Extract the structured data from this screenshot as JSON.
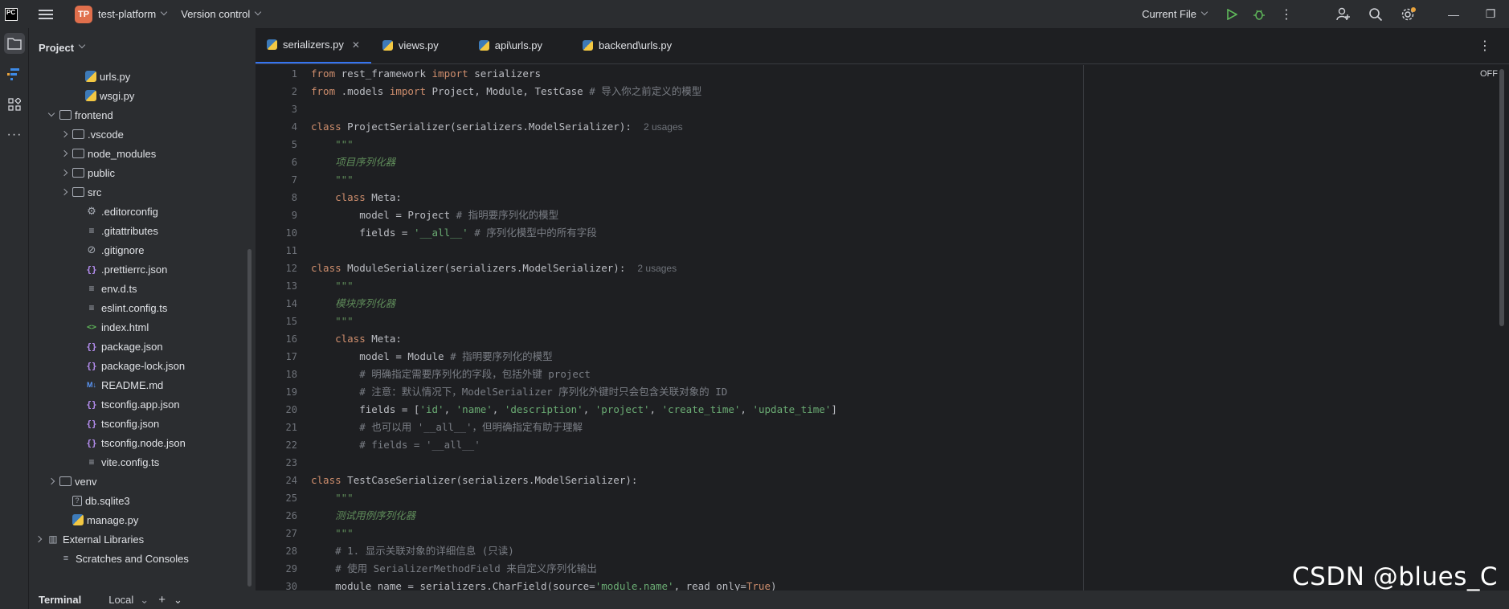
{
  "titlebar": {
    "logo_text": "PC",
    "project_badge": "TP",
    "project_name": "test-platform",
    "vcs_label": "Version control",
    "run_config": "Current File"
  },
  "toolstrip": {
    "items": [
      "project-view",
      "structure",
      "plugins",
      "more"
    ]
  },
  "project_panel": {
    "title": "Project",
    "tree": [
      {
        "label": "urls.py",
        "icon": "python-icon",
        "indent": 4
      },
      {
        "label": "wsgi.py",
        "icon": "python-icon",
        "indent": 4
      },
      {
        "label": "frontend",
        "icon": "folder-icon",
        "indent": 2,
        "expanded": true
      },
      {
        "label": ".vscode",
        "icon": "folder-icon",
        "indent": 3,
        "collapsed": true
      },
      {
        "label": "node_modules",
        "icon": "folder-icon",
        "indent": 3,
        "collapsed": true
      },
      {
        "label": "public",
        "icon": "folder-icon",
        "indent": 3,
        "collapsed": true
      },
      {
        "label": "src",
        "icon": "folder-icon",
        "indent": 3,
        "collapsed": true
      },
      {
        "label": ".editorconfig",
        "icon": "gear-icon",
        "indent": 4
      },
      {
        "label": ".gitattributes",
        "icon": "text-icon",
        "indent": 4
      },
      {
        "label": ".gitignore",
        "icon": "ignore-icon",
        "indent": 4
      },
      {
        "label": ".prettierrc.json",
        "icon": "json-icon",
        "indent": 4
      },
      {
        "label": "env.d.ts",
        "icon": "text-icon",
        "indent": 4
      },
      {
        "label": "eslint.config.ts",
        "icon": "text-icon",
        "indent": 4
      },
      {
        "label": "index.html",
        "icon": "html-icon",
        "indent": 4
      },
      {
        "label": "package.json",
        "icon": "json-icon",
        "indent": 4
      },
      {
        "label": "package-lock.json",
        "icon": "json-icon",
        "indent": 4
      },
      {
        "label": "README.md",
        "icon": "markdown-icon",
        "indent": 4
      },
      {
        "label": "tsconfig.app.json",
        "icon": "json-icon",
        "indent": 4
      },
      {
        "label": "tsconfig.json",
        "icon": "json-icon",
        "indent": 4
      },
      {
        "label": "tsconfig.node.json",
        "icon": "json-icon",
        "indent": 4
      },
      {
        "label": "vite.config.ts",
        "icon": "text-icon",
        "indent": 4
      },
      {
        "label": "venv",
        "icon": "folder-icon",
        "indent": 2,
        "collapsed": true
      },
      {
        "label": "db.sqlite3",
        "icon": "database-icon",
        "indent": 3
      },
      {
        "label": "manage.py",
        "icon": "python-icon",
        "indent": 3
      },
      {
        "label": "External Libraries",
        "icon": "library-icon",
        "indent": 1,
        "collapsed": true
      },
      {
        "label": "Scratches and Consoles",
        "icon": "console-icon",
        "indent": 2
      }
    ]
  },
  "tabs": [
    {
      "label": "serializers.py",
      "active": true
    },
    {
      "label": "views.py",
      "active": false
    },
    {
      "label": "api\\urls.py",
      "active": false
    },
    {
      "label": "backend\\urls.py",
      "active": false
    }
  ],
  "editor": {
    "reader_mode": "OFF",
    "line_numbers": [
      "1",
      "2",
      "3",
      "4",
      "5",
      "6",
      "7",
      "8",
      "9",
      "10",
      "11",
      "12",
      "13",
      "14",
      "15",
      "16",
      "17",
      "18",
      "19",
      "20",
      "21",
      "22",
      "23",
      "24",
      "25",
      "26",
      "27",
      "28",
      "29",
      "30"
    ],
    "lines": [
      [
        {
          "t": "from",
          "c": "kw"
        },
        {
          "t": " rest_framework "
        },
        {
          "t": "import",
          "c": "kw"
        },
        {
          "t": " serializers"
        }
      ],
      [
        {
          "t": "from",
          "c": "kw"
        },
        {
          "t": " .models "
        },
        {
          "t": "import",
          "c": "kw"
        },
        {
          "t": " Project, Module, TestCase "
        },
        {
          "t": "# 导入你之前定义的模型",
          "c": "cmt"
        }
      ],
      [],
      [
        {
          "t": "class",
          "c": "kw"
        },
        {
          "t": " ProjectSerializer(serializers.ModelSerializer):  "
        },
        {
          "t": "2 usages",
          "c": "hint"
        }
      ],
      [
        {
          "t": "    \"\"\"",
          "c": "doc"
        }
      ],
      [
        {
          "t": "    项目序列化器",
          "c": "doc"
        }
      ],
      [
        {
          "t": "    \"\"\"",
          "c": "doc"
        }
      ],
      [
        {
          "t": "    "
        },
        {
          "t": "class",
          "c": "kw"
        },
        {
          "t": " Meta:"
        }
      ],
      [
        {
          "t": "        model = Project "
        },
        {
          "t": "# 指明要序列化的模型",
          "c": "cmt"
        }
      ],
      [
        {
          "t": "        fields = "
        },
        {
          "t": "'__all__'",
          "c": "str"
        },
        {
          "t": " "
        },
        {
          "t": "# 序列化模型中的所有字段",
          "c": "cmt"
        }
      ],
      [],
      [
        {
          "t": "class",
          "c": "kw"
        },
        {
          "t": " ModuleSerializer(serializers.ModelSerializer):  "
        },
        {
          "t": "2 usages",
          "c": "hint"
        }
      ],
      [
        {
          "t": "    \"\"\"",
          "c": "doc"
        }
      ],
      [
        {
          "t": "    模块序列化器",
          "c": "doc"
        }
      ],
      [
        {
          "t": "    \"\"\"",
          "c": "doc"
        }
      ],
      [
        {
          "t": "    "
        },
        {
          "t": "class",
          "c": "kw"
        },
        {
          "t": " Meta:"
        }
      ],
      [
        {
          "t": "        model = Module "
        },
        {
          "t": "# 指明要序列化的模型",
          "c": "cmt"
        }
      ],
      [
        {
          "t": "        # 明确指定需要序列化的字段，包括外键 project",
          "c": "cmt"
        }
      ],
      [
        {
          "t": "        # 注意：默认情况下，ModelSerializer 序列化外键时只会包含关联对象的 ID",
          "c": "cmt"
        }
      ],
      [
        {
          "t": "        fields = ["
        },
        {
          "t": "'id'",
          "c": "str"
        },
        {
          "t": ", "
        },
        {
          "t": "'name'",
          "c": "str"
        },
        {
          "t": ", "
        },
        {
          "t": "'description'",
          "c": "str"
        },
        {
          "t": ", "
        },
        {
          "t": "'project'",
          "c": "str"
        },
        {
          "t": ", "
        },
        {
          "t": "'create_time'",
          "c": "str"
        },
        {
          "t": ", "
        },
        {
          "t": "'update_time'",
          "c": "str"
        },
        {
          "t": "]"
        }
      ],
      [
        {
          "t": "        # 也可以用 '__all__'，但明确指定有助于理解",
          "c": "cmt"
        }
      ],
      [
        {
          "t": "        # fields = '__all__'",
          "c": "cmt"
        }
      ],
      [],
      [
        {
          "t": "class",
          "c": "kw"
        },
        {
          "t": " TestCaseSerializer(serializers.ModelSerializer):"
        }
      ],
      [
        {
          "t": "    \"\"\"",
          "c": "doc"
        }
      ],
      [
        {
          "t": "    测试用例序列化器",
          "c": "doc"
        }
      ],
      [
        {
          "t": "    \"\"\"",
          "c": "doc"
        }
      ],
      [
        {
          "t": "    # 1. 显示关联对象的详细信息 (只读)",
          "c": "cmt"
        }
      ],
      [
        {
          "t": "    # 使用 SerializerMethodField 来自定义序列化输出",
          "c": "cmt"
        }
      ],
      [
        {
          "t": "    module_name = serializers.CharField(source="
        },
        {
          "t": "'module.name'",
          "c": "str"
        },
        {
          "t": ", read_only="
        },
        {
          "t": "True",
          "c": "kw"
        },
        {
          "t": ")"
        }
      ]
    ]
  },
  "bottombar": {
    "terminal_label": "Terminal",
    "local_label": "Local"
  },
  "watermark": "CSDN @blues_C",
  "colors": {
    "accent": "#3574f0",
    "keyword": "#cf8e6d",
    "string": "#6aab73",
    "comment": "#7a7e85",
    "docstring": "#5f8c5a",
    "project_badge": "#e06f4c"
  }
}
